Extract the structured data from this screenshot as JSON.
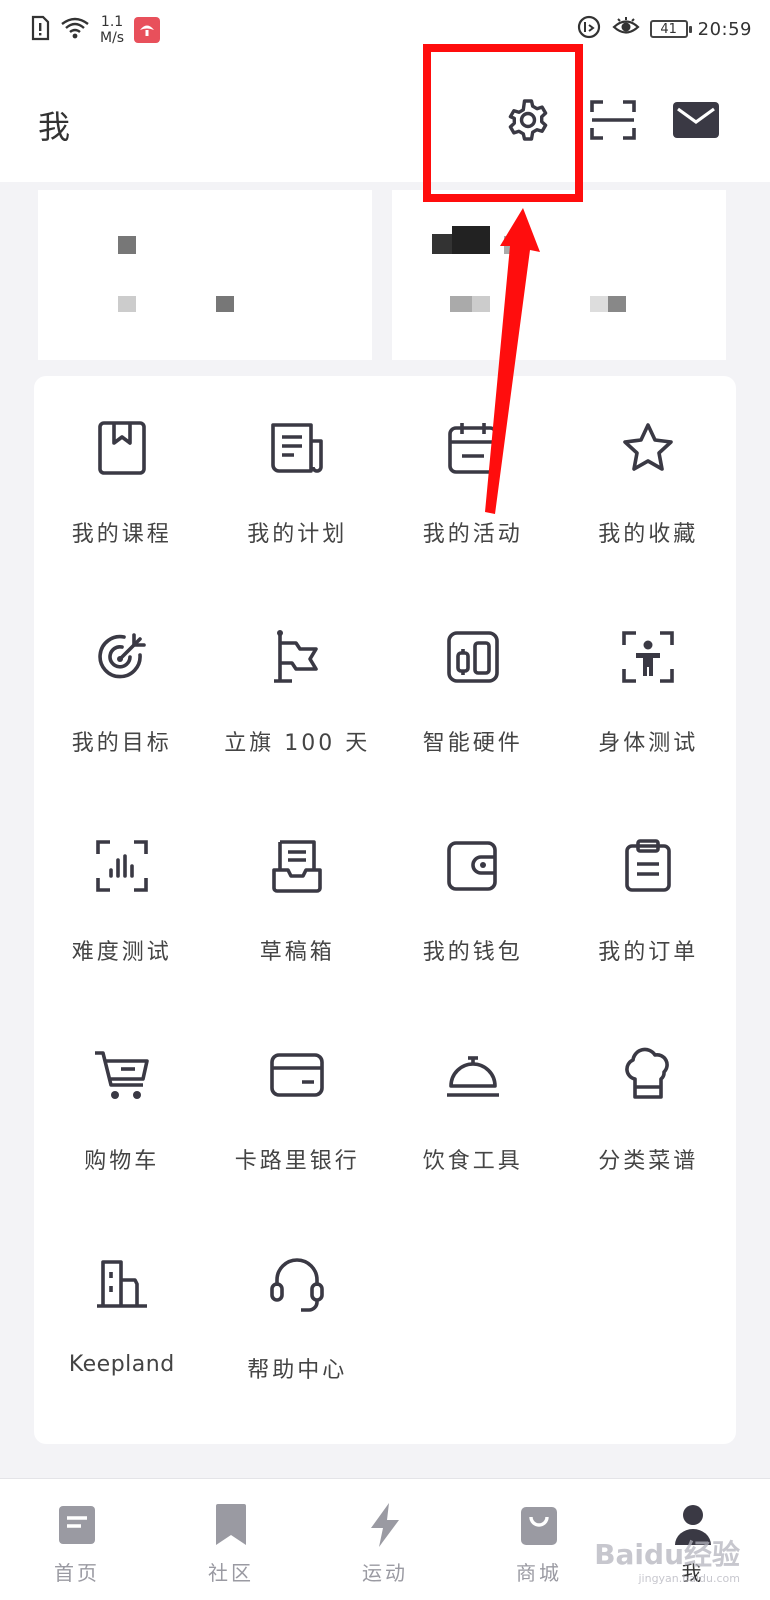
{
  "status_bar": {
    "net_speed_value": "1.1",
    "net_speed_unit": "M/s",
    "battery": "41",
    "time": "20:59"
  },
  "header": {
    "title": "我",
    "icons": [
      "gear-icon",
      "scan-icon",
      "mail-icon"
    ]
  },
  "annotation": {
    "highlight_color": "#ff0d0d"
  },
  "grid": {
    "items": [
      {
        "label": "我的课程",
        "icon": "book-icon"
      },
      {
        "label": "我的计划",
        "icon": "plan-document-icon"
      },
      {
        "label": "我的活动",
        "icon": "calendar-icon"
      },
      {
        "label": "我的收藏",
        "icon": "star-icon"
      },
      {
        "label": "我的目标",
        "icon": "target-icon"
      },
      {
        "label": "立旗 100 天",
        "icon": "flag-icon"
      },
      {
        "label": "智能硬件",
        "icon": "smart-device-icon"
      },
      {
        "label": "身体测试",
        "icon": "body-scan-icon"
      },
      {
        "label": "难度测试",
        "icon": "bar-scan-icon"
      },
      {
        "label": "草稿箱",
        "icon": "inbox-icon"
      },
      {
        "label": "我的钱包",
        "icon": "wallet-icon"
      },
      {
        "label": "我的订单",
        "icon": "clipboard-icon"
      },
      {
        "label": "购物车",
        "icon": "cart-icon"
      },
      {
        "label": "卡路里银行",
        "icon": "card-icon"
      },
      {
        "label": "饮食工具",
        "icon": "cloche-icon"
      },
      {
        "label": "分类菜谱",
        "icon": "chef-hat-icon"
      },
      {
        "label": "Keepland",
        "icon": "building-icon"
      },
      {
        "label": "帮助中心",
        "icon": "headset-icon"
      }
    ]
  },
  "bottom_nav": {
    "items": [
      {
        "label": "首页",
        "icon": "home-icon",
        "active": false
      },
      {
        "label": "社区",
        "icon": "bookmark-icon",
        "active": false
      },
      {
        "label": "运动",
        "icon": "lightning-icon",
        "active": false
      },
      {
        "label": "商城",
        "icon": "shopping-bag-icon",
        "active": false
      },
      {
        "label": "我",
        "icon": "profile-icon",
        "active": true
      }
    ]
  },
  "watermark": {
    "main": "Baidu经验",
    "sub": "jingyan.baidu.com"
  }
}
